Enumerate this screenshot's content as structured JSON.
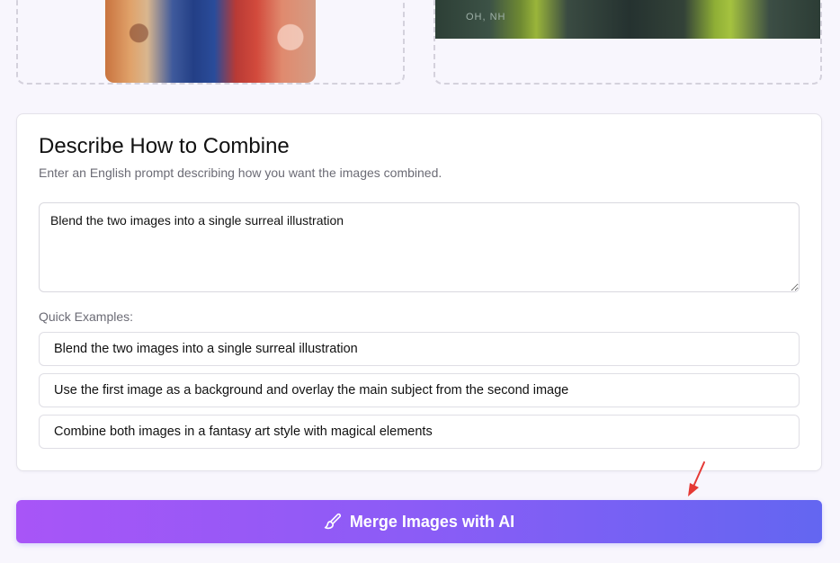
{
  "uploads": {
    "right_image_text": "OH, NH"
  },
  "combine": {
    "title": "Describe How to Combine",
    "subtitle": "Enter an English prompt describing how you want the images combined.",
    "prompt_value": "Blend the two images into a single surreal illustration",
    "examples_label": "Quick Examples:",
    "examples": [
      "Blend the two images into a single surreal illustration",
      "Use the first image as a background and overlay the main subject from the second image",
      "Combine both images in a fantasy art style with magical elements"
    ]
  },
  "merge_button": {
    "label": "Merge Images with AI",
    "icon": "paintbrush-icon"
  },
  "colors": {
    "accent_start": "#a855f7",
    "accent_end": "#6366f1",
    "annotation_arrow": "#e53935"
  }
}
